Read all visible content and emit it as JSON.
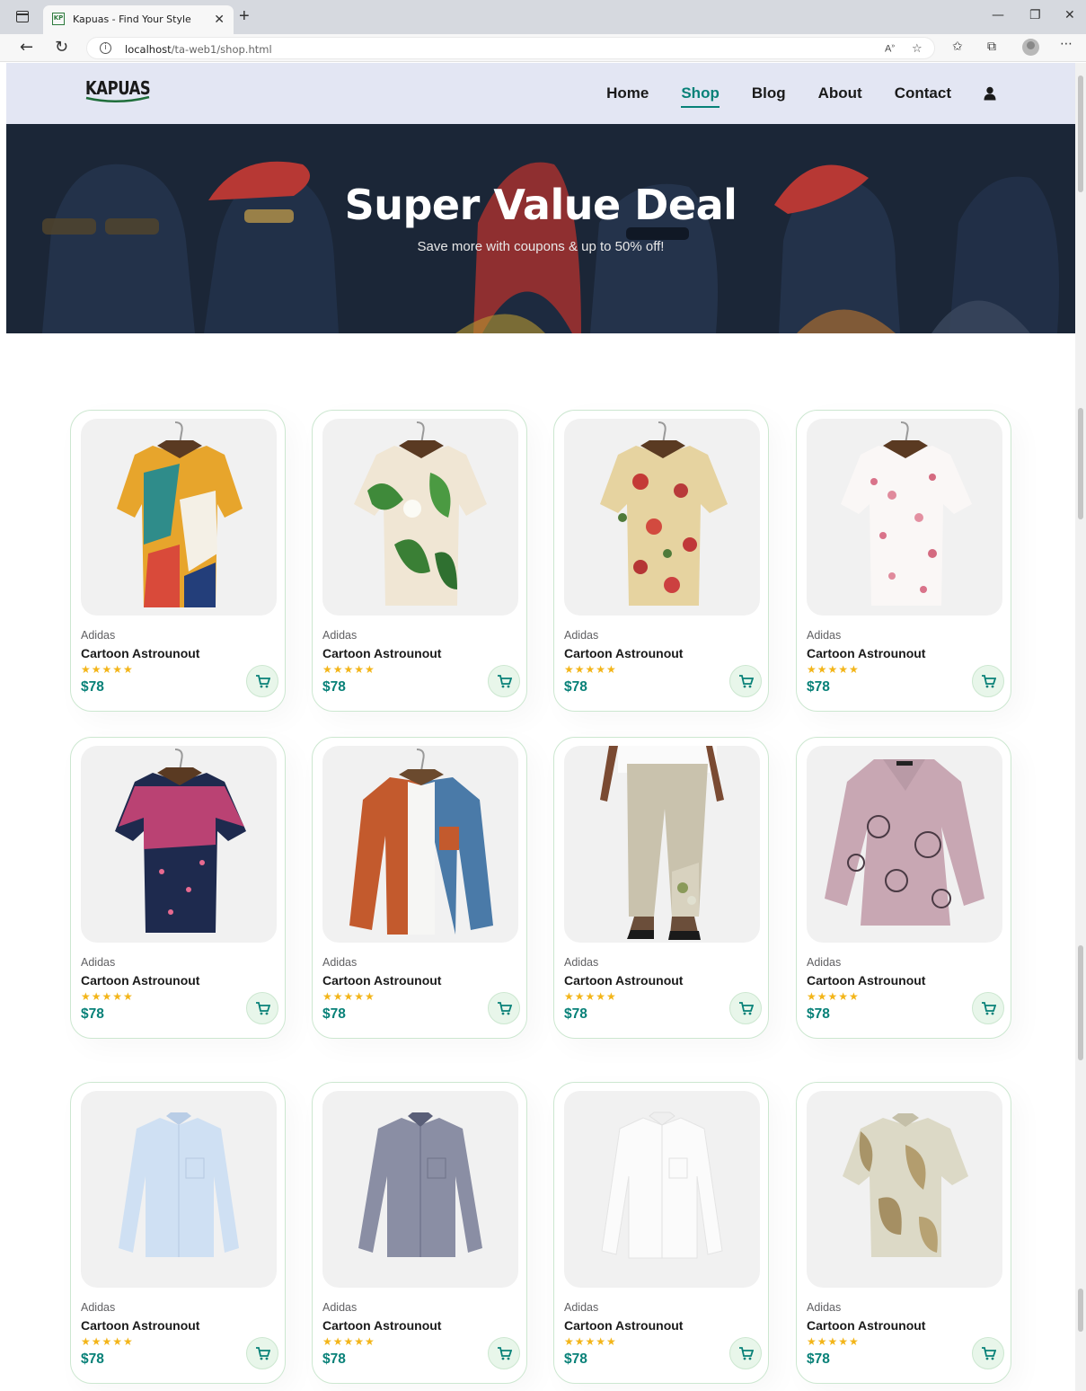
{
  "browser": {
    "tab_title": "Kapuas - Find Your Style",
    "favicon_text": "KP",
    "url_host": "localhost",
    "url_path": "/ta-web1/shop.html",
    "icons": [
      "window-icon",
      "close-tab-icon",
      "new-tab-icon",
      "minimize-icon",
      "restore-icon",
      "close-window-icon",
      "back-icon",
      "refresh-icon",
      "info-icon",
      "read-aloud-icon",
      "favorite-icon",
      "favorites-icon",
      "collections-icon",
      "profile-icon",
      "more-icon"
    ]
  },
  "header": {
    "logo_text": "KAPUAS",
    "nav": [
      {
        "label": "Home",
        "active": false
      },
      {
        "label": "Shop",
        "active": true
      },
      {
        "label": "Blog",
        "active": false
      },
      {
        "label": "About",
        "active": false
      },
      {
        "label": "Contact",
        "active": false
      }
    ],
    "user_icon": "user-icon"
  },
  "hero": {
    "title": "Super Value Deal",
    "subtitle": "Save more with coupons & up to 50% off!"
  },
  "products": [
    {
      "brand": "Adidas",
      "name": "Cartoon Astrounout",
      "rating": 5,
      "price": "$78",
      "image": "colorful-abstract-shirt"
    },
    {
      "brand": "Adidas",
      "name": "Cartoon Astrounout",
      "rating": 5,
      "price": "$78",
      "image": "cream-floral-leaf-shirt"
    },
    {
      "brand": "Adidas",
      "name": "Cartoon Astrounout",
      "rating": 5,
      "price": "$78",
      "image": "beige-rose-print-shirt"
    },
    {
      "brand": "Adidas",
      "name": "Cartoon Astrounout",
      "rating": 5,
      "price": "$78",
      "image": "white-pink-blossom-shirt"
    },
    {
      "brand": "Adidas",
      "name": "Cartoon Astrounout",
      "rating": 5,
      "price": "$78",
      "image": "navy-pink-floral-shirt"
    },
    {
      "brand": "Adidas",
      "name": "Cartoon Astrounout",
      "rating": 5,
      "price": "$78",
      "image": "orange-blue-overshirt"
    },
    {
      "brand": "Adidas",
      "name": "Cartoon Astrounout",
      "rating": 5,
      "price": "$78",
      "image": "linen-trousers"
    },
    {
      "brand": "Adidas",
      "name": "Cartoon Astrounout",
      "rating": 5,
      "price": "$78",
      "image": "mauve-paisley-blouse"
    },
    {
      "brand": "Adidas",
      "name": "Cartoon Astrounout",
      "rating": 5,
      "price": "$78",
      "image": "light-blue-long-sleeve-shirt"
    },
    {
      "brand": "Adidas",
      "name": "Cartoon Astrounout",
      "rating": 5,
      "price": "$78",
      "image": "grey-check-long-sleeve-shirt"
    },
    {
      "brand": "Adidas",
      "name": "Cartoon Astrounout",
      "rating": 5,
      "price": "$78",
      "image": "white-long-sleeve-shirt"
    },
    {
      "brand": "Adidas",
      "name": "Cartoon Astrounout",
      "rating": 5,
      "price": "$78",
      "image": "cream-tan-print-shirt"
    }
  ],
  "colors": {
    "accent": "#088178",
    "header_bg": "#e3e6f3",
    "star": "#f3b519",
    "card_border": "#cce7d0",
    "cart_bg": "#e8f6ea"
  }
}
